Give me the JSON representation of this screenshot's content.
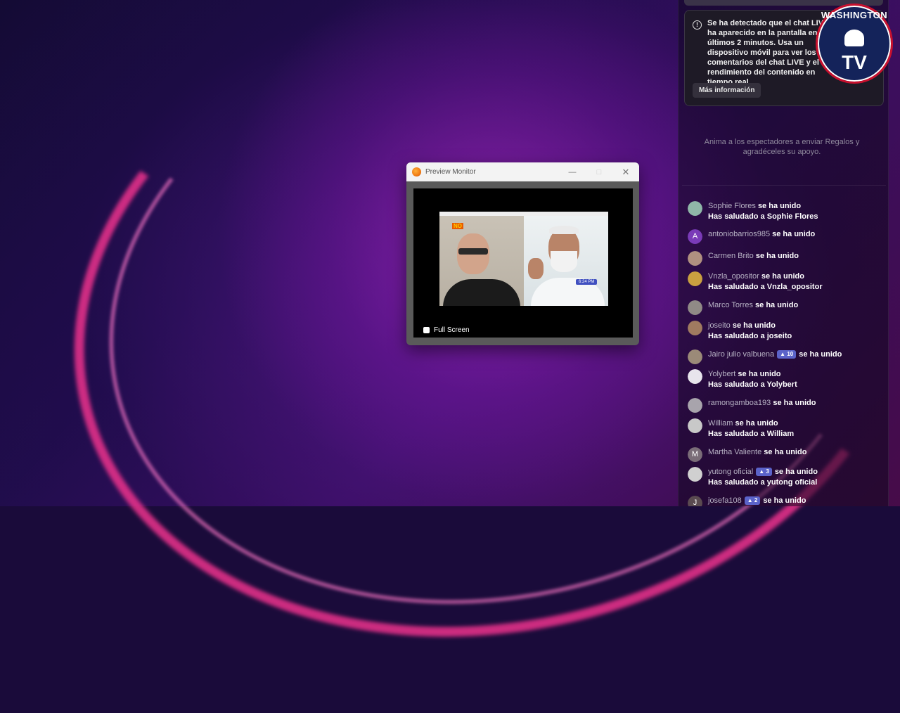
{
  "preview_window": {
    "title": "Preview Monitor",
    "fullscreen_label": "Full Screen",
    "video": {
      "logo": "NO",
      "time_badge": "6:24 PM"
    }
  },
  "side_panel": {
    "notice": {
      "text": "Se ha detectado que el chat LIVE ha aparecido en la pantalla en los últimos 2 minutos. Usa un dispositivo móvil para ver los comentarios del chat LIVE y el rendimiento del contenido en tiempo real.",
      "button_label": "Más información"
    },
    "gift_hint": "Anima a los espectadores a enviar Regalos y agradéceles su apoyo.",
    "feed": [
      {
        "user": "Sophie Flores",
        "action": "se ha unido",
        "greeting": "Has saludado a Sophie Flores",
        "avatar_color": "#8fb7a8"
      },
      {
        "user": "antoniobarrios985",
        "action": "se ha unido",
        "avatar_letter": "A",
        "avatar_color": "#7a3bb8"
      },
      {
        "user": "Carmen Brito",
        "action": "se ha unido",
        "avatar_color": "#b09080"
      },
      {
        "user": "Vnzla_opositor",
        "action": "se ha unido",
        "greeting": "Has saludado a Vnzla_opositor",
        "avatar_color": "#c9a040"
      },
      {
        "user": "Marco Torres",
        "action": "se ha unido",
        "avatar_color": "#908a86"
      },
      {
        "user": "joseito",
        "action": "se ha unido",
        "greeting": "Has saludado a joseito",
        "avatar_color": "#a07a60"
      },
      {
        "user": "Jairo julio valbuena",
        "badge": "10",
        "action": "se ha unido",
        "avatar_color": "#9b8a78"
      },
      {
        "user": "Yolybert",
        "action": "se ha unido",
        "greeting": "Has saludado a Yolybert",
        "avatar_color": "#e8e4ec"
      },
      {
        "user": "ramongamboa193",
        "action": "se ha unido",
        "avatar_color": "#a8a4ac"
      },
      {
        "user": "William",
        "action": "se ha unido",
        "greeting": "Has saludado a William",
        "avatar_color": "#c8c8c8"
      },
      {
        "user": "Martha Valiente",
        "action": "se ha unido",
        "avatar_letter": "M",
        "avatar_color": "#7a6d78"
      },
      {
        "user": "yutong oficial",
        "badge": "3",
        "action": "se ha unido",
        "greeting": "Has saludado a yutong oficial",
        "avatar_color": "#d0d0d0"
      },
      {
        "user": "josefa108",
        "badge": "2",
        "action": "se ha unido",
        "avatar_letter": "J",
        "avatar_color": "#5a4a50"
      }
    ]
  },
  "logo": {
    "ring_text": "WASHINGTON",
    "text": "TV"
  }
}
